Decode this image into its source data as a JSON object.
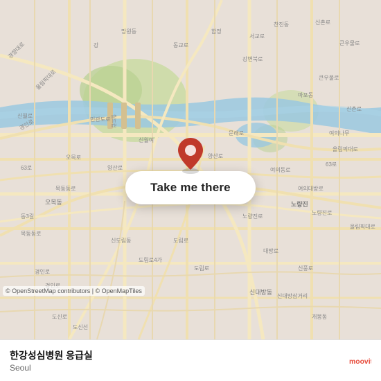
{
  "map": {
    "background_color": "#e8e0d8",
    "attribution": "© OpenStreetMap contributors | © OpenMapTiles"
  },
  "button": {
    "label": "Take me there"
  },
  "place": {
    "name": "한강성심병원 응급실",
    "city": "Seoul"
  },
  "logo": {
    "text": "moovit",
    "color": "#e74c3c"
  }
}
